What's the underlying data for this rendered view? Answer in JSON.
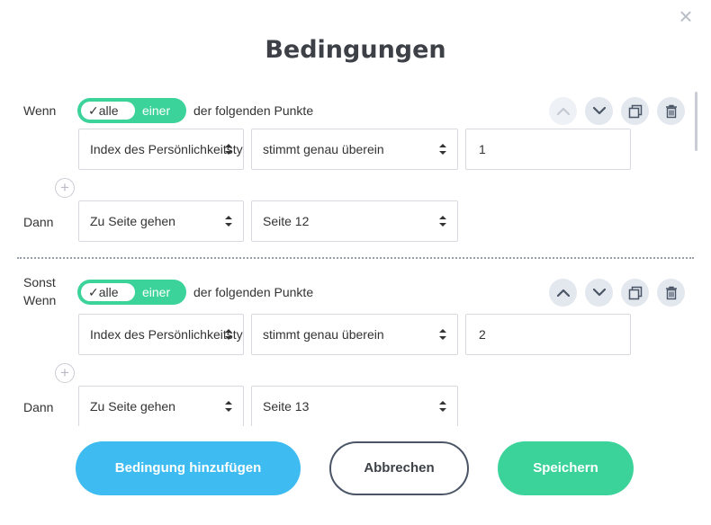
{
  "modal": {
    "title": "Bedingungen",
    "close_icon": "close-icon"
  },
  "conditions": [
    {
      "label": "Wenn",
      "toggle": {
        "selected": "alle",
        "other": "einer"
      },
      "tail": "der folgenden Punkte",
      "field": "Index des Persönlichkeitstyps",
      "operator": "stimmt genau überein",
      "value": "1",
      "then_label": "Dann",
      "action": "Zu Seite gehen",
      "target": "Seite 12"
    },
    {
      "label": "Sonst Wenn",
      "toggle": {
        "selected": "alle",
        "other": "einer"
      },
      "tail": "der folgenden Punkte",
      "field": "Index des Persönlichkeitstyps",
      "operator": "stimmt genau überein",
      "value": "2",
      "then_label": "Dann",
      "action": "Zu Seite gehen",
      "target": "Seite 13"
    }
  ],
  "footer": {
    "add_label": "Bedingung hinzufügen",
    "cancel_label": "Abbrechen",
    "save_label": "Speichern"
  },
  "colors": {
    "green": "#3cd39a",
    "blue": "#3ebbf0",
    "icon_bg": "#e3e7ee"
  },
  "icons": [
    "chevron-up-icon",
    "chevron-down-icon",
    "copy-icon",
    "trash-icon",
    "plus-icon",
    "select-arrows-icon",
    "check-icon"
  ]
}
